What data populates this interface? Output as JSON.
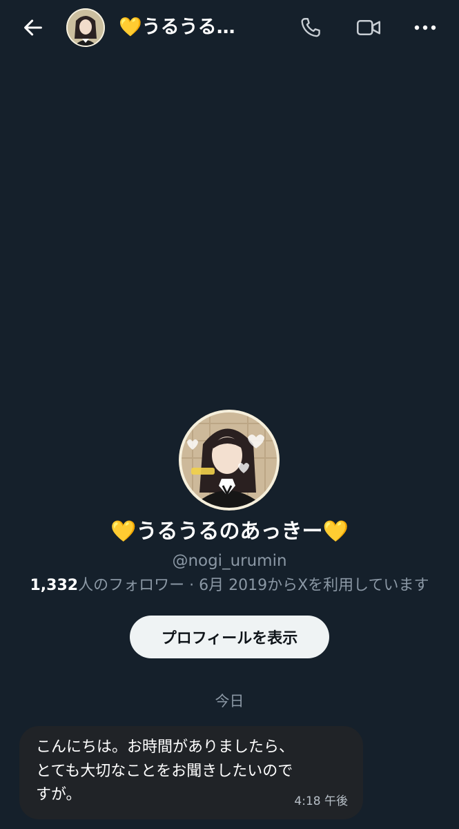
{
  "header": {
    "title": "💛うるうる…",
    "back_icon": "arrow-left-icon",
    "call_icon": "phone-icon",
    "video_icon": "video-camera-icon",
    "more_icon": "more-horizontal-icon"
  },
  "profile": {
    "display_name": "💛うるうるのあっきー💛",
    "handle": "@nogi_urumin",
    "followers_count": "1,332",
    "followers_label": "人のフォロワー",
    "separator": " · ",
    "joined": "6月 2019からXを利用しています",
    "view_profile_label": "プロフィールを表示"
  },
  "conversation": {
    "date_separator": "今日",
    "messages": [
      {
        "text": "こんにちは。お時間がありましたら、\nとても大切なことをお聞きしたいので\nすが。",
        "time": "4:18 午後"
      }
    ]
  },
  "colors": {
    "background": "#15202b",
    "bubble": "#202327",
    "secondary_text": "#8b98a5",
    "button_bg": "#eff3f4"
  }
}
